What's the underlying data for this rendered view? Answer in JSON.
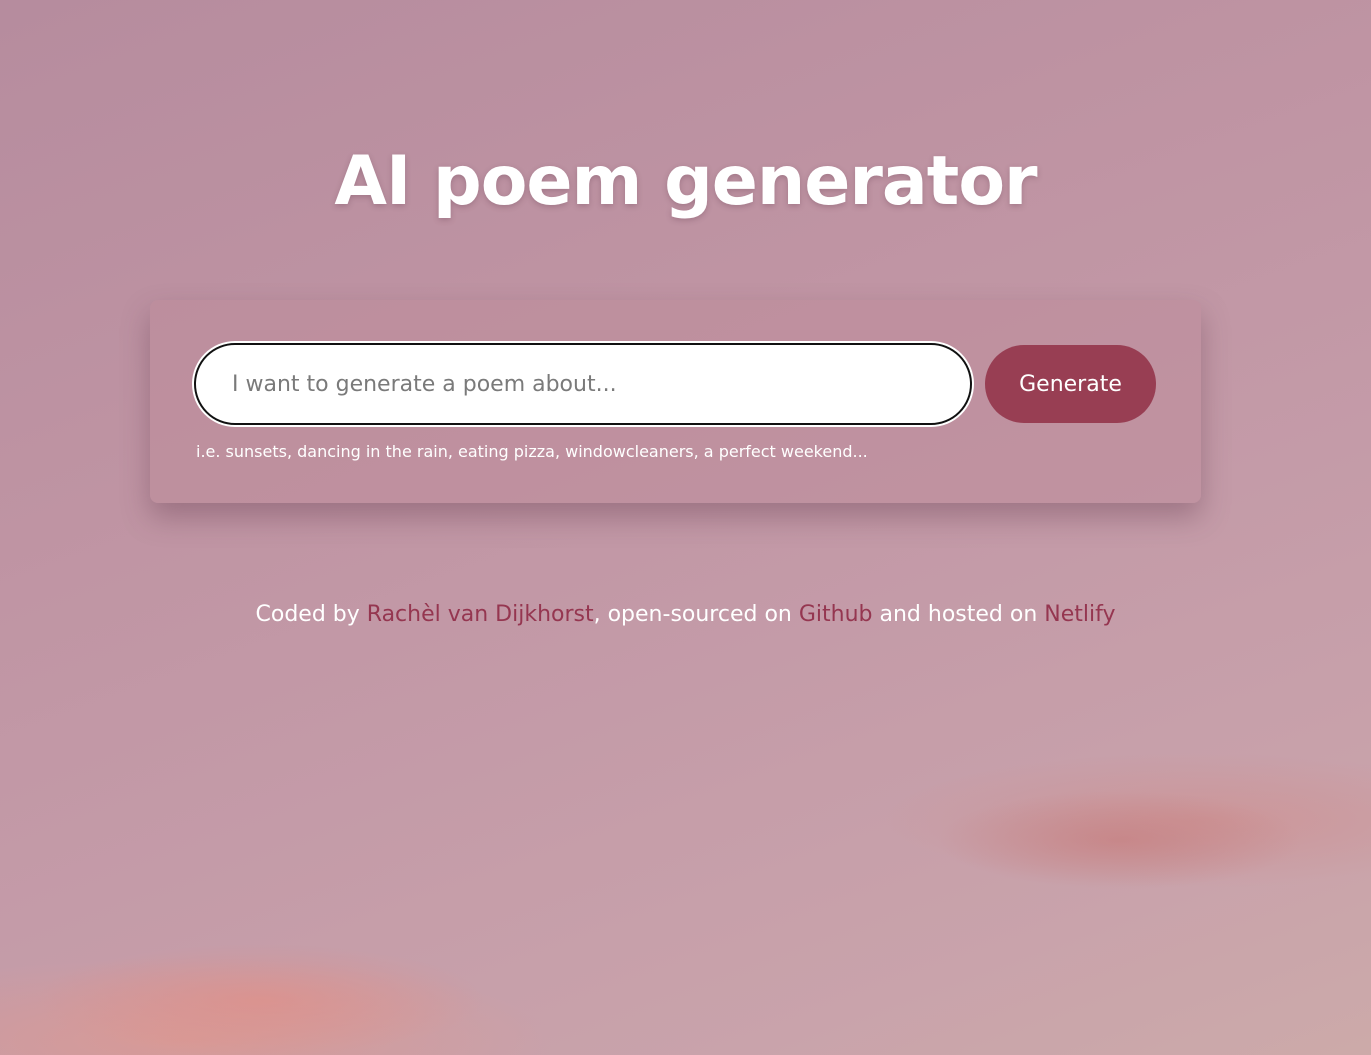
{
  "page": {
    "title": "AI poem generator"
  },
  "form": {
    "input_value": "",
    "input_placeholder": "I want to generate a poem about...",
    "button_label": "Generate",
    "hint": "i.e. sunsets, dancing in the rain, eating pizza, windowcleaners, a perfect weekend..."
  },
  "footer": {
    "coded_by": "Coded by ",
    "author_link": "Rachèl van Dijkhorst",
    "mid_text_1": ", open-sourced on ",
    "github_link": "Github",
    "mid_text_2": " and hosted on ",
    "netlify_link": "Netlify"
  },
  "colors": {
    "accent": "#983e53",
    "link": "#953650",
    "text_light": "#ffffff"
  }
}
